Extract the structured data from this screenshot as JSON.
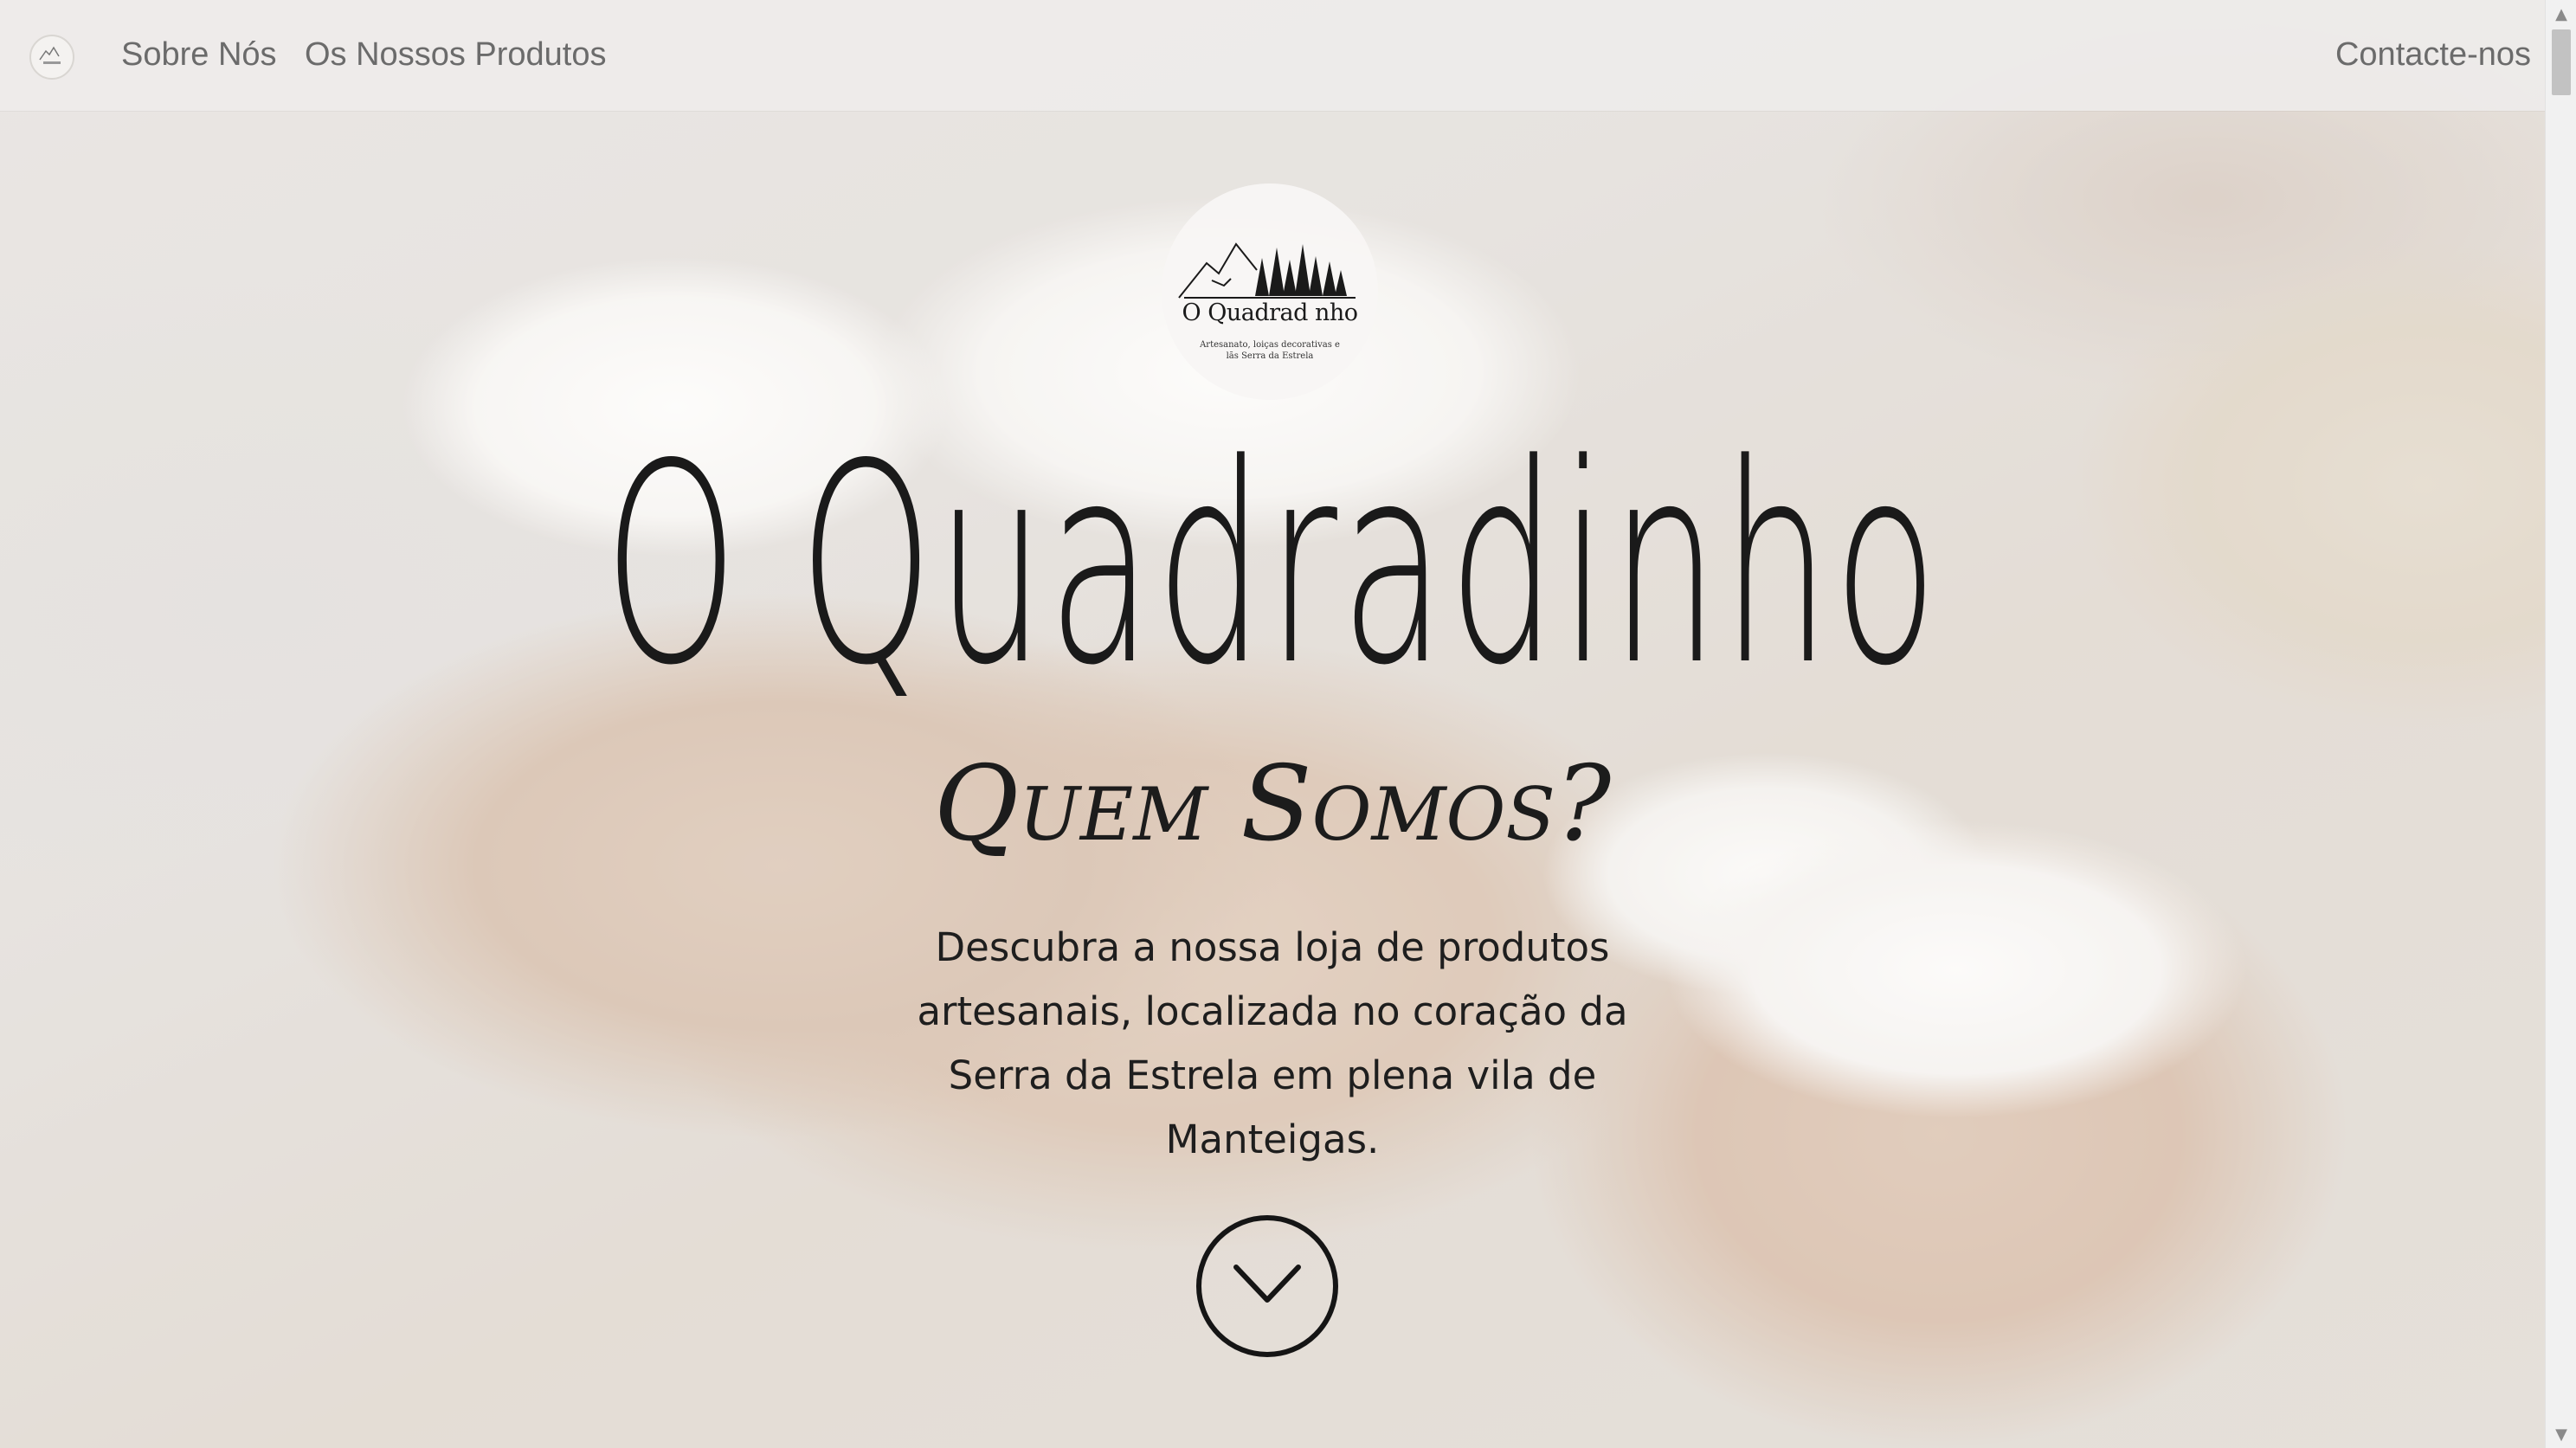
{
  "navbar": {
    "logo_icon": "shop-logo-icon",
    "links": {
      "about": "Sobre Nós",
      "products": "Os Nossos Produtos",
      "contact": "Contacte-nos"
    }
  },
  "hero": {
    "badge": {
      "name": "O Quadrad nho",
      "tagline": "Artesanato, loiças decorativas e lãs Serra da Estrela",
      "icon": "mountain-trees-logo-icon"
    },
    "title": "O Quadradinho",
    "subtitle": "Quem Somos?",
    "description": "Descubra a nossa loja de produtos artesanais, localizada no coração da Serra da Estrela em plena vila de Manteigas.",
    "scroll_button_icon": "chevron-down-icon"
  },
  "scrollbar": {
    "up_icon": "scroll-up-arrow-icon",
    "down_icon": "scroll-down-arrow-icon",
    "up_glyph": "▲",
    "down_glyph": "▼"
  },
  "colors": {
    "text": "#1a1a1a",
    "nav_text": "#6b6b6b",
    "navbar_bg": "#eeecea",
    "slipper_tan": "#c8a489"
  }
}
